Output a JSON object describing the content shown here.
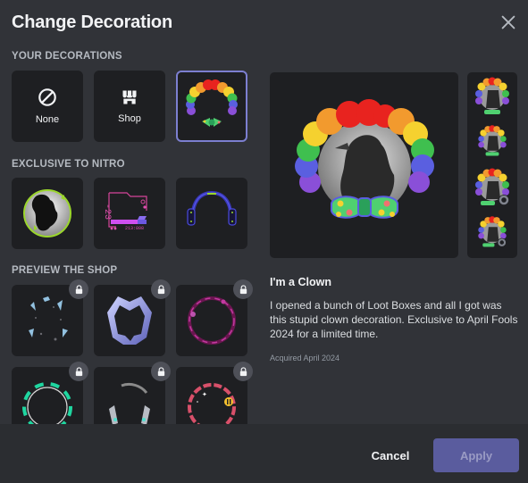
{
  "modal": {
    "title": "Change Decoration",
    "close_icon": "close-icon"
  },
  "sections": {
    "your_decorations": "YOUR DECORATIONS",
    "exclusive_nitro": "EXCLUSIVE TO NITRO",
    "preview_shop": "PREVIEW THE SHOP"
  },
  "your_decorations": [
    {
      "label": "None",
      "icon": "none-icon"
    },
    {
      "label": "Shop",
      "icon": "shop-icon"
    },
    {
      "label": "",
      "icon": "clown-decoration",
      "selected": true
    }
  ],
  "nitro_decorations": [
    {
      "icon": "splatter-decoration"
    },
    {
      "icon": "cyber-hud-decoration"
    },
    {
      "icon": "neon-headphones-decoration"
    }
  ],
  "shop_decorations": [
    {
      "icon": "butterflies-decoration",
      "locked": true
    },
    {
      "icon": "crystal-decoration",
      "locked": true
    },
    {
      "icon": "magenta-flame-decoration",
      "locked": true
    },
    {
      "icon": "teal-ring-decoration",
      "locked": true
    },
    {
      "icon": "silver-wings-decoration",
      "locked": true
    },
    {
      "icon": "bee-ring-decoration",
      "locked": true
    }
  ],
  "selected": {
    "name": "I'm a Clown",
    "description": "I opened a bunch of Loot Boxes and all I got was this stupid clown decoration. Exclusive to April Fools 2024 for a limited time.",
    "acquired": "Acquired April 2024"
  },
  "colors": {
    "accent": "#7c7fd0",
    "apply_bg": "#5a5c9e",
    "background": "#313338",
    "footer": "#2b2d31",
    "tile": "#1e1f22"
  },
  "footer": {
    "cancel_label": "Cancel",
    "apply_label": "Apply"
  }
}
